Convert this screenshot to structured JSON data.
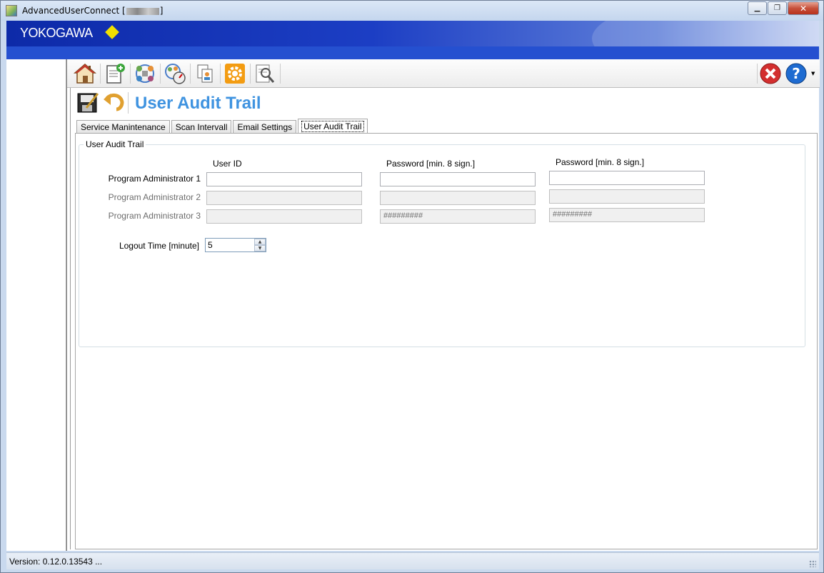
{
  "window": {
    "title": "AdvancedUserConnect [",
    "title_suffix": "]",
    "minimize_glyph": "▁",
    "restore_glyph": "❐",
    "close_glyph": "✕"
  },
  "banner": {
    "logo_text": "YOKOGAWA",
    "brand_color": "#f0e000"
  },
  "toolbar": {
    "items": [
      {
        "icon": "home-icon"
      },
      {
        "icon": "add-document-icon"
      },
      {
        "icon": "network-users-icon"
      },
      {
        "icon": "scan-gauge-icon"
      },
      {
        "icon": "user-documents-icon"
      },
      {
        "icon": "settings-gear-icon"
      },
      {
        "icon": "audit-search-icon"
      }
    ],
    "right_items": [
      {
        "icon": "close-red-icon"
      },
      {
        "icon": "help-icon"
      }
    ]
  },
  "page": {
    "title": "User Audit Trail",
    "title_color": "#3f93e0",
    "save_icon": "save-icon",
    "undo_icon": "undo-icon"
  },
  "tabs": [
    {
      "label": "Service Manintenance",
      "active": false
    },
    {
      "label": "Scan Intervall",
      "active": false
    },
    {
      "label": "Email Settings",
      "active": false
    },
    {
      "label": "User Audit Trail",
      "active": true
    }
  ],
  "audit": {
    "group_title": "User Audit Trail",
    "col_user_id": "User ID",
    "col_password": "Password [min. 8 sign.]",
    "col_password_confirm": "Password [min. 8 sign.]",
    "rows": [
      {
        "label": "Program Administrator 1",
        "user_id": "",
        "password": "",
        "password_confirm": "",
        "enabled": true
      },
      {
        "label": "Program Administrator 2",
        "user_id": "",
        "password": "",
        "password_confirm": "",
        "enabled": false
      },
      {
        "label": "Program Administrator 3",
        "user_id": "",
        "password": "#########",
        "password_confirm": "#########",
        "enabled": false
      }
    ],
    "logout_label": "Logout Time [minute]",
    "logout_value": "5"
  },
  "status": {
    "version_text": "Version: 0.12.0.13543  ..."
  }
}
